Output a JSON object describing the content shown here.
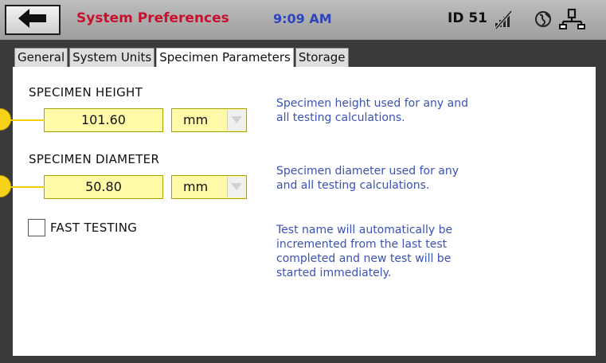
{
  "header": {
    "title": "System Preferences",
    "time": "9:09 AM",
    "user_id": "ID 51",
    "icons": [
      "back-arrow-icon",
      "no-signal-icon",
      "globe-icon",
      "network-icon"
    ]
  },
  "tabs": [
    {
      "label": "General",
      "active": false
    },
    {
      "label": "System Units",
      "active": false
    },
    {
      "label": "Specimen Parameters",
      "active": true
    },
    {
      "label": "Storage",
      "active": false
    }
  ],
  "specimen_height": {
    "label": "SPECIMEN HEIGHT",
    "value": "101.60",
    "unit": "mm",
    "description_line1": "Specimen height used for any and",
    "description_line2": "all testing calculations."
  },
  "specimen_diameter": {
    "label": "SPECIMEN DIAMETER",
    "value": "50.80",
    "unit": "mm",
    "description_line1": "Specimen diameter used for any",
    "description_line2": "and all testing calculations."
  },
  "fast_testing": {
    "label": "FAST TESTING",
    "checked": false,
    "description_line1": "Test name will automatically be",
    "description_line2": "incremented from the last test",
    "description_line3": "completed and new test will be",
    "description_line4": "started immediately."
  },
  "colors": {
    "title": "#c8102e",
    "clock": "#2f44b8",
    "description": "#3a52b4",
    "input_fill": "#fff9a8",
    "callout": "#f7d21b"
  }
}
